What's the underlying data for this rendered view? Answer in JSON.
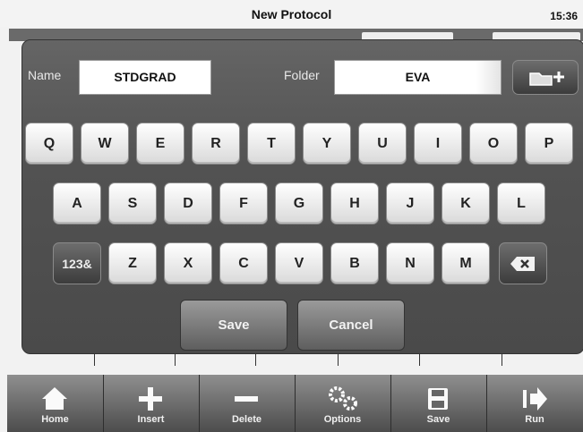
{
  "header": {
    "title": "New Protocol",
    "clock": "15:36"
  },
  "form": {
    "name_label": "Name",
    "name_value": "STDGRAD",
    "folder_label": "Folder",
    "folder_value": "EVA"
  },
  "keyboard": {
    "row1": [
      "Q",
      "W",
      "E",
      "R",
      "T",
      "Y",
      "U",
      "I",
      "O",
      "P"
    ],
    "row2": [
      "A",
      "S",
      "D",
      "F",
      "G",
      "H",
      "J",
      "K",
      "L"
    ],
    "row3": [
      "Z",
      "X",
      "C",
      "V",
      "B",
      "N",
      "M"
    ],
    "numeric_toggle": "123&",
    "backspace_icon": "backspace-icon"
  },
  "dialog_buttons": {
    "save": "Save",
    "cancel": "Cancel"
  },
  "toolbar": [
    {
      "label": "Home",
      "icon": "home-icon"
    },
    {
      "label": "Insert",
      "icon": "plus-icon"
    },
    {
      "label": "Delete",
      "icon": "minus-icon"
    },
    {
      "label": "Options",
      "icon": "gears-icon"
    },
    {
      "label": "Save",
      "icon": "floppy-icon"
    },
    {
      "label": "Run",
      "icon": "run-icon"
    }
  ],
  "colors": {
    "dialog": "#555555",
    "key": "#f4f4f4",
    "toolbar": "#6a6a6a"
  }
}
